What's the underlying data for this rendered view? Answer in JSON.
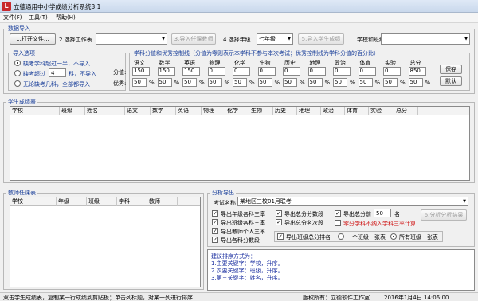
{
  "window": {
    "title": "立德通用中小学成绩分析系统3.1",
    "icon_letter": "L"
  },
  "menu": [
    {
      "label": "文件(F)"
    },
    {
      "label": "工具(T)"
    },
    {
      "label": "帮助(H)"
    }
  ],
  "import": {
    "group_title": "数据导入",
    "open_file_button": "1.打开文件…",
    "select_sheet_label": "2.选择工作表",
    "select_sheet_value": "",
    "import_teacher_button": "3.导入任课教师",
    "select_grade_label": "4.选择年级",
    "select_grade_value": "七年级",
    "import_scores_button": "5.导入学生成绩",
    "school_class_label": "学校和班级",
    "school_class_value": ""
  },
  "import_options": {
    "group_title": "导入选项",
    "options": [
      {
        "label": "缺考学科超过一半，不导入",
        "selected": true
      },
      {
        "prefix": "缺考超过",
        "value": "4",
        "suffix": "科，不导入",
        "selected": false
      },
      {
        "label": "无论缺考几科，全部都导入",
        "selected": false
      }
    ]
  },
  "score_settings": {
    "group_title": "学科分值和优秀控制线（分值为零则表示本学科不参与本次考试；优秀控制线为学科分值的百分比）",
    "subjects": [
      "语文",
      "数学",
      "英语",
      "物理",
      "化学",
      "生物",
      "历史",
      "地理",
      "政治",
      "体育",
      "实验",
      "总分"
    ],
    "score_label": "分值:",
    "scores": [
      "150",
      "150",
      "150",
      "0",
      "0",
      "0",
      "0",
      "0",
      "0",
      "0",
      "0",
      "850"
    ],
    "excellent_label": "优秀:",
    "excellent": [
      "50",
      "50",
      "50",
      "50",
      "50",
      "50",
      "50",
      "50",
      "50",
      "50",
      "50",
      "50"
    ],
    "percent": "%",
    "save_button": "保存",
    "default_button": "默认"
  },
  "student_scores": {
    "group_title": "学生成绩表",
    "columns": [
      "学校",
      "班级",
      "姓名",
      "语文",
      "数学",
      "英语",
      "物理",
      "化学",
      "生物",
      "历史",
      "地理",
      "政治",
      "体育",
      "实验",
      "总分"
    ]
  },
  "teachers": {
    "group_title": "教师任课表",
    "columns": [
      "学校",
      "年级",
      "班级",
      "学科",
      "教师"
    ]
  },
  "analysis": {
    "group_title": "分析导出",
    "exam_name_label": "考试名称",
    "exam_name_value": "某地区三校01月联考",
    "checks": {
      "grade_subject_three_rates": {
        "label": "导出年级各科三率",
        "checked": true
      },
      "class_subject_three_rates": {
        "label": "导出班级各科三率",
        "checked": true
      },
      "teacher_three_rates": {
        "label": "导出教师个人三率",
        "checked": true
      },
      "subject_score_distribution": {
        "label": "导出各科分数段",
        "checked": true
      },
      "total_score_distribution": {
        "label": "导出总分分数段",
        "checked": true
      },
      "total_score_rank": {
        "label": "导出总分名次段",
        "checked": true
      },
      "total_top_prefix": {
        "label": "导出总分前",
        "checked": true
      },
      "zero_subject_excluded": {
        "label": "零分学科不纳入学科三率计算",
        "checked": false
      },
      "class_total_rank": {
        "label": "导出班级总分排名",
        "checked": true
      }
    },
    "top_n_value": "50",
    "top_n_suffix": "名",
    "start_button": "6.分析分析结果",
    "sheet_mode_options": [
      {
        "label": "一个班级一张表",
        "selected": false
      },
      {
        "label": "所有班级一张表",
        "selected": true
      }
    ]
  },
  "hint": {
    "title": "建议排序方式为：",
    "lines": [
      "1.主要关键字：学校，升序。",
      "2.次要关键字：班级，升序。",
      "3.第三关键字：姓名，升序。"
    ]
  },
  "status": {
    "left": "双击学生成绩表，复制某一行成绩到剪贴板；单击列标题，对某一列进行排序",
    "copyright": "版权所有：立德软件工作室",
    "datetime": "2016年1月4日 14:06:00"
  },
  "colors": {
    "group_title": "#1a3f9a",
    "hint_text": "#1b2fa0",
    "warning": "#d01818"
  }
}
